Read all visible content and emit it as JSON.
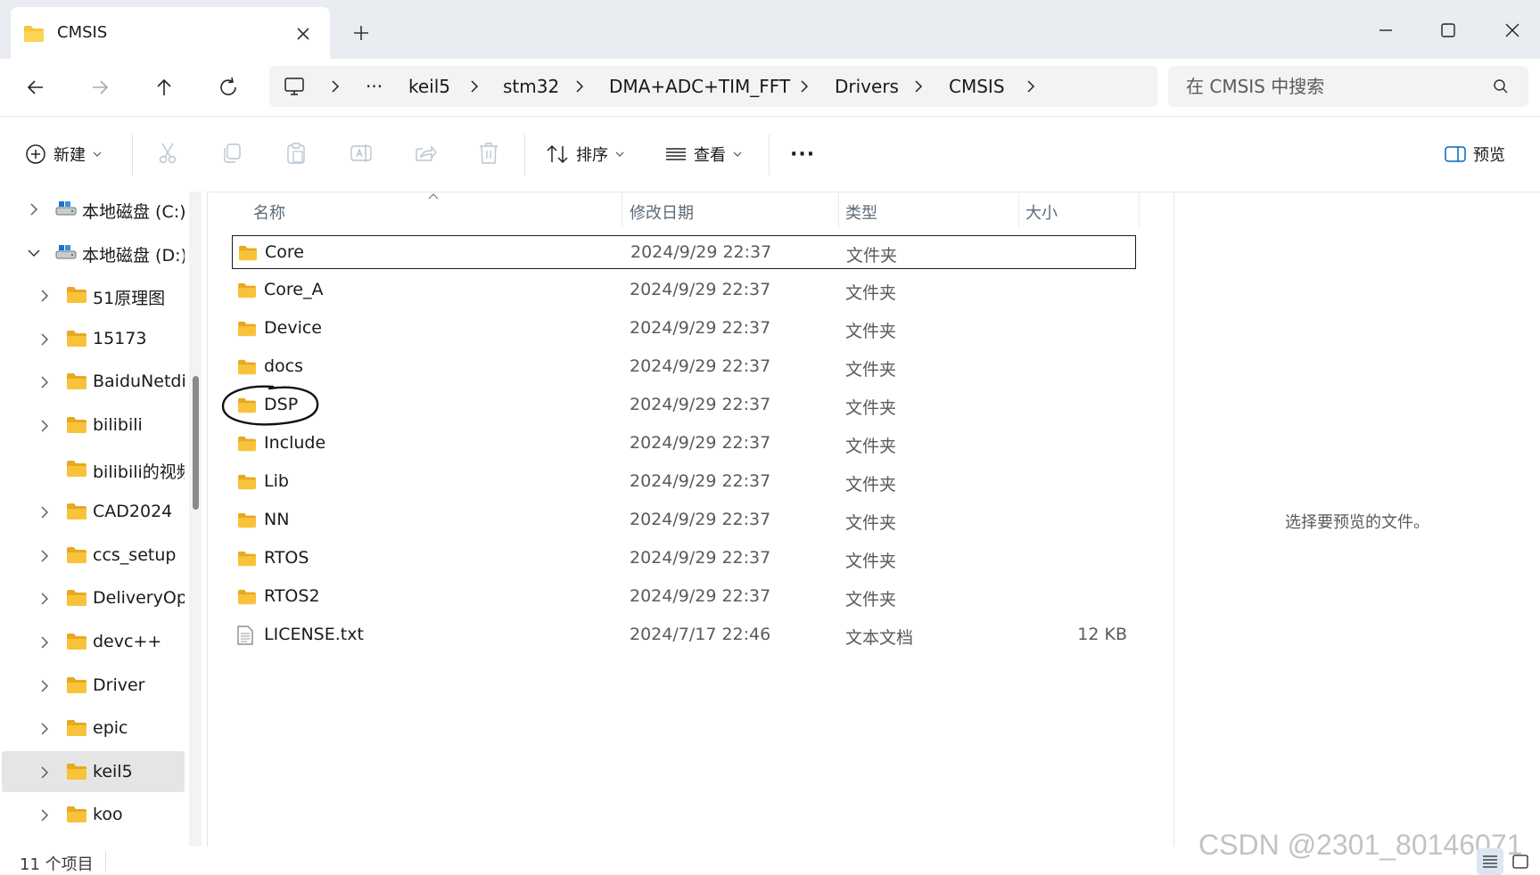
{
  "tab": {
    "title": "CMSIS"
  },
  "breadcrumb": {
    "overflow": "···",
    "items": [
      "keil5",
      "stm32",
      "DMA+ADC+TIM_FFT",
      "Drivers",
      "CMSIS"
    ]
  },
  "search": {
    "placeholder": "在 CMSIS 中搜索"
  },
  "toolbar": {
    "new_label": "新建",
    "sort_label": "排序",
    "view_label": "查看",
    "more_label": "···",
    "preview_label": "预览"
  },
  "sidebar": {
    "items": [
      {
        "label": "本地磁盘 (C:)",
        "icon": "drive-icon",
        "expanded": false,
        "level": 0
      },
      {
        "label": "本地磁盘 (D:)",
        "icon": "drive-icon",
        "expanded": true,
        "level": 0
      },
      {
        "label": "51原理图",
        "icon": "folder-icon",
        "level": 1
      },
      {
        "label": "15173",
        "icon": "folder-icon",
        "level": 1
      },
      {
        "label": "BaiduNetdis",
        "icon": "folder-icon",
        "level": 1
      },
      {
        "label": "bilibili",
        "icon": "folder-icon",
        "level": 1
      },
      {
        "label": "bilibili的视频",
        "icon": "folder-icon",
        "level": 1,
        "no_chevron": true
      },
      {
        "label": "CAD2024",
        "icon": "folder-icon",
        "level": 1
      },
      {
        "label": "ccs_setup",
        "icon": "folder-icon",
        "level": 1
      },
      {
        "label": "DeliveryOpt",
        "icon": "folder-icon",
        "level": 1
      },
      {
        "label": "devc++",
        "icon": "folder-icon",
        "level": 1
      },
      {
        "label": "Driver",
        "icon": "folder-icon",
        "level": 1
      },
      {
        "label": "epic",
        "icon": "folder-icon",
        "level": 1
      },
      {
        "label": "keil5",
        "icon": "folder-icon",
        "level": 1,
        "selected": true
      },
      {
        "label": "koo",
        "icon": "folder-icon",
        "level": 1
      }
    ]
  },
  "columns": {
    "name": "名称",
    "modified": "修改日期",
    "type": "类型",
    "size": "大小"
  },
  "files": [
    {
      "name": "Core",
      "modified": "2024/9/29 22:37",
      "type": "文件夹",
      "size": "",
      "icon": "folder-icon",
      "focused": true
    },
    {
      "name": "Core_A",
      "modified": "2024/9/29 22:37",
      "type": "文件夹",
      "size": "",
      "icon": "folder-icon"
    },
    {
      "name": "Device",
      "modified": "2024/9/29 22:37",
      "type": "文件夹",
      "size": "",
      "icon": "folder-icon"
    },
    {
      "name": "docs",
      "modified": "2024/9/29 22:37",
      "type": "文件夹",
      "size": "",
      "icon": "folder-icon"
    },
    {
      "name": "DSP",
      "modified": "2024/9/29 22:37",
      "type": "文件夹",
      "size": "",
      "icon": "folder-icon",
      "annotated": true
    },
    {
      "name": "Include",
      "modified": "2024/9/29 22:37",
      "type": "文件夹",
      "size": "",
      "icon": "folder-icon"
    },
    {
      "name": "Lib",
      "modified": "2024/9/29 22:37",
      "type": "文件夹",
      "size": "",
      "icon": "folder-icon"
    },
    {
      "name": "NN",
      "modified": "2024/9/29 22:37",
      "type": "文件夹",
      "size": "",
      "icon": "folder-icon"
    },
    {
      "name": "RTOS",
      "modified": "2024/9/29 22:37",
      "type": "文件夹",
      "size": "",
      "icon": "folder-icon"
    },
    {
      "name": "RTOS2",
      "modified": "2024/9/29 22:37",
      "type": "文件夹",
      "size": "",
      "icon": "folder-icon"
    },
    {
      "name": "LICENSE.txt",
      "modified": "2024/7/17 22:46",
      "type": "文本文档",
      "size": "12 KB",
      "icon": "text-file-icon"
    }
  ],
  "preview": {
    "empty_text": "选择要预览的文件。"
  },
  "status": {
    "item_count": "11 个项目"
  },
  "watermark": "CSDN @2301_80146071",
  "colors": {
    "folder": "#f8c33a",
    "folder_dark": "#e8a820",
    "accent": "#0067c0",
    "selected_row": "#e5e5e5"
  }
}
